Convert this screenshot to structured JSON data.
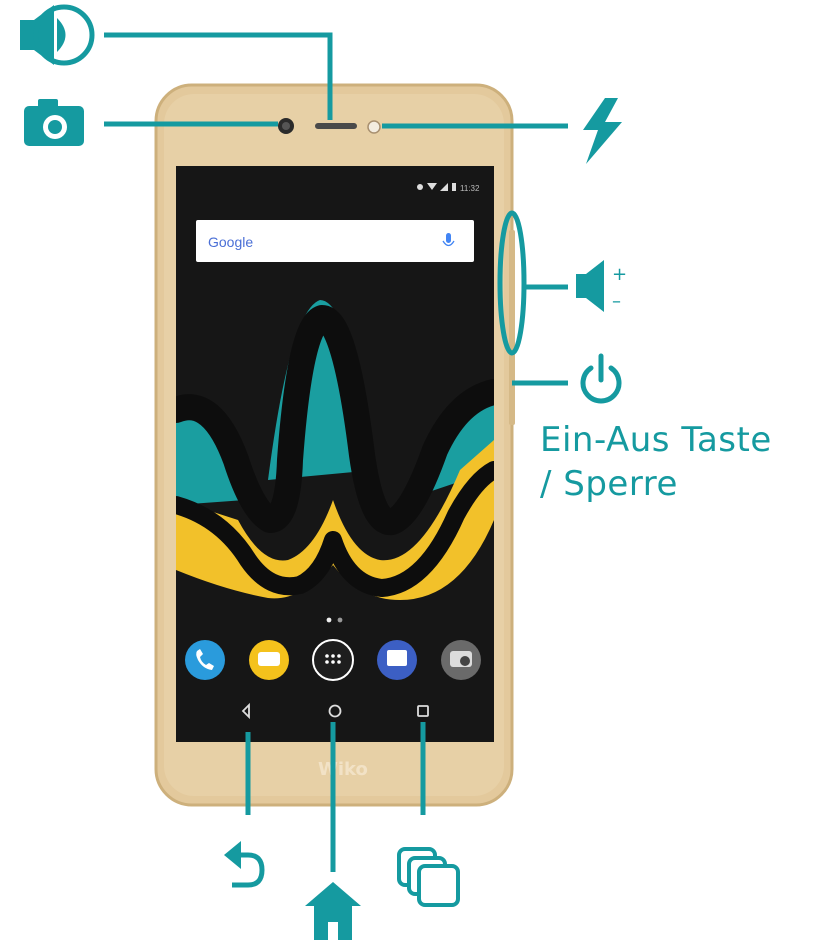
{
  "colors": {
    "accent": "#159aa0",
    "phone_gold": "#e3c99c",
    "screen": "#161616",
    "wave_teal": "#1a9ea0",
    "wave_yellow": "#f2c12a"
  },
  "phone": {
    "search_bar_text": "Google",
    "brand_logo": "Wiko",
    "status_bar_time": "11:32"
  },
  "callouts": {
    "speaker": {
      "icon": "speaker-icon"
    },
    "camera": {
      "icon": "camera-icon"
    },
    "flash": {
      "icon": "flash-icon"
    },
    "volume": {
      "icon": "volume-icon",
      "plus": "+",
      "minus": "–"
    },
    "power": {
      "icon": "power-icon",
      "label_line1": "Ein-Aus Taste",
      "label_line2": "/ Sperre"
    },
    "back": {
      "icon": "back-arrow-icon"
    },
    "home": {
      "icon": "home-icon"
    },
    "recent_apps": {
      "icon": "recent-apps-icon"
    }
  }
}
